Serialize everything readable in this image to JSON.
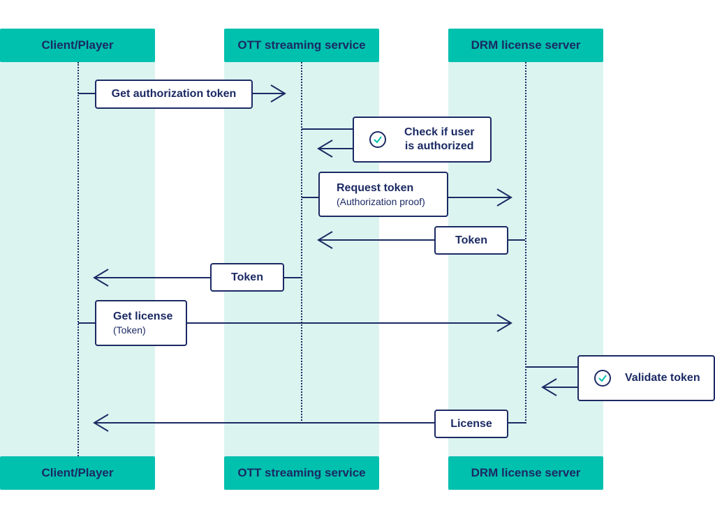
{
  "lanes": [
    {
      "name": "Client/Player"
    },
    {
      "name": "OTT streaming service"
    },
    {
      "name": "DRM license server"
    }
  ],
  "messages": [
    {
      "from": "Client/Player",
      "to": "OTT streaming service",
      "title": "Get authorization token",
      "subtitle": ""
    },
    {
      "from": "OTT streaming service",
      "to": "OTT streaming service",
      "title": "Check if user is authorized",
      "subtitle": "",
      "icon": "check-circle-icon"
    },
    {
      "from": "OTT streaming service",
      "to": "DRM license server",
      "title": "Request token",
      "subtitle": "(Authorization proof)"
    },
    {
      "from": "DRM license server",
      "to": "OTT streaming service",
      "title": "Token",
      "subtitle": ""
    },
    {
      "from": "OTT streaming service",
      "to": "Client/Player",
      "title": "Token",
      "subtitle": ""
    },
    {
      "from": "Client/Player",
      "to": "DRM license server",
      "title": "Get license",
      "subtitle": "(Token)"
    },
    {
      "from": "DRM license server",
      "to": "DRM license server",
      "title": "Validate token",
      "subtitle": "",
      "icon": "check-circle-icon"
    },
    {
      "from": "DRM license server",
      "to": "Client/Player",
      "title": "License",
      "subtitle": ""
    }
  ],
  "labels": {
    "check_line1": "Check if user",
    "check_line2": "is authorized"
  },
  "colors": {
    "header": "#00c0ae",
    "lane": "#dcf4f0",
    "ink": "#1b2a63",
    "check": "#00c0ae"
  }
}
